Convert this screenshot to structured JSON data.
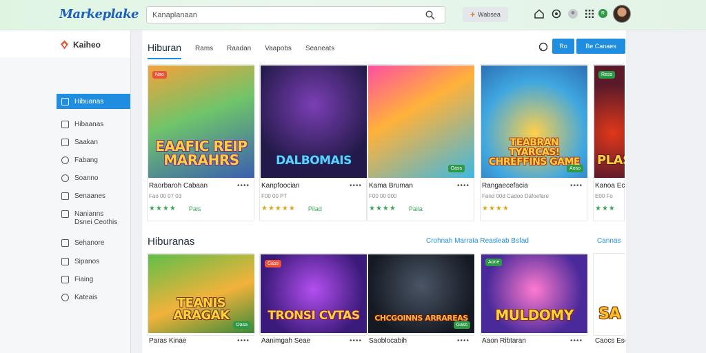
{
  "header": {
    "logo": "Markeplake",
    "search_value": "Kanaplanaan",
    "action_label": "Wabsea",
    "avatar_letter": "R"
  },
  "sidebar": {
    "title": "Kaiheo",
    "items": [
      {
        "label": "Hibuanas",
        "active": true
      },
      {
        "label": "Hibaanas"
      },
      {
        "label": "Saakan"
      },
      {
        "label": "Fabang"
      },
      {
        "label": "Soanno"
      },
      {
        "label": "Senaanes"
      },
      {
        "label": "Nanianns"
      },
      {
        "label": "Dsnei Ceothis",
        "sub": true
      },
      {
        "label": "Sehanore"
      },
      {
        "label": "Sipanos"
      },
      {
        "label": "Fiaing"
      },
      {
        "label": "Kateais"
      }
    ]
  },
  "main": {
    "tabs": [
      "Hiburan",
      "Rams",
      "Raadan",
      "Vaapobs",
      "Seaneats"
    ],
    "btn_small": "Ro",
    "btn_large": "Be Canaes",
    "section_title": "Hiburanas",
    "section_link": "Crohnah Marrata Reasleab Bsfad",
    "section_link2": "Cannas"
  },
  "row1": [
    {
      "art": "EAAFIC REIP MARAHRS",
      "badge": "Nao",
      "name": "Raorbaroh Cabaan",
      "sub": "Fao 00 07 03",
      "stars": "★★★★",
      "tag": "Pals",
      "gold": false
    },
    {
      "art": "DALBOMAIS",
      "badge": "",
      "name": "Kanpfoocian",
      "sub": "F00 00 PT",
      "stars": "★★★★★",
      "tag": "Pilad",
      "gold": true
    },
    {
      "art": "",
      "badge": "Oass",
      "name": "Kama Bruman",
      "sub": "F00 00 000",
      "stars": "★★★★",
      "tag": "Paila",
      "gold": false
    },
    {
      "art": "TEABRAN TYARCAS! CHREFFINS GAME",
      "badge": "Aoso",
      "name": "Rangaecefacia",
      "sub": "Fand 00d Cadoo Dafoefare",
      "stars": "★★★★",
      "tag": "",
      "gold": true
    },
    {
      "art": "PLAS",
      "badge": "Ress",
      "name": "Kanoa Eca",
      "sub": "E00 Fo",
      "stars": "★★★",
      "tag": "",
      "gold": false
    }
  ],
  "row2": [
    {
      "art": "TEANIS ARAGAK",
      "badge": "Oasa",
      "name": "Paras Kinae",
      "sub": "",
      "stars": "",
      "tag": ""
    },
    {
      "art": "TRONSI CVTAS",
      "badge": "Cass",
      "name": "Aanimgah Seae",
      "sub": "",
      "stars": "",
      "tag": ""
    },
    {
      "art": "CHCGOINNS ARRAREAS",
      "badge": "Gass",
      "name": "Saoblocabih",
      "sub": "",
      "stars": "",
      "tag": ""
    },
    {
      "art": "MULDOMY",
      "badge": "Aone",
      "name": "Aaon Ribtaran",
      "sub": "",
      "stars": "",
      "tag": ""
    },
    {
      "art": "SA",
      "badge": "",
      "name": "Caocs Eso",
      "sub": "",
      "stars": "",
      "tag": ""
    }
  ],
  "colors": {
    "accent": "#1f8ee0",
    "green": "#3aa55a",
    "gold": "#e0a31a"
  }
}
